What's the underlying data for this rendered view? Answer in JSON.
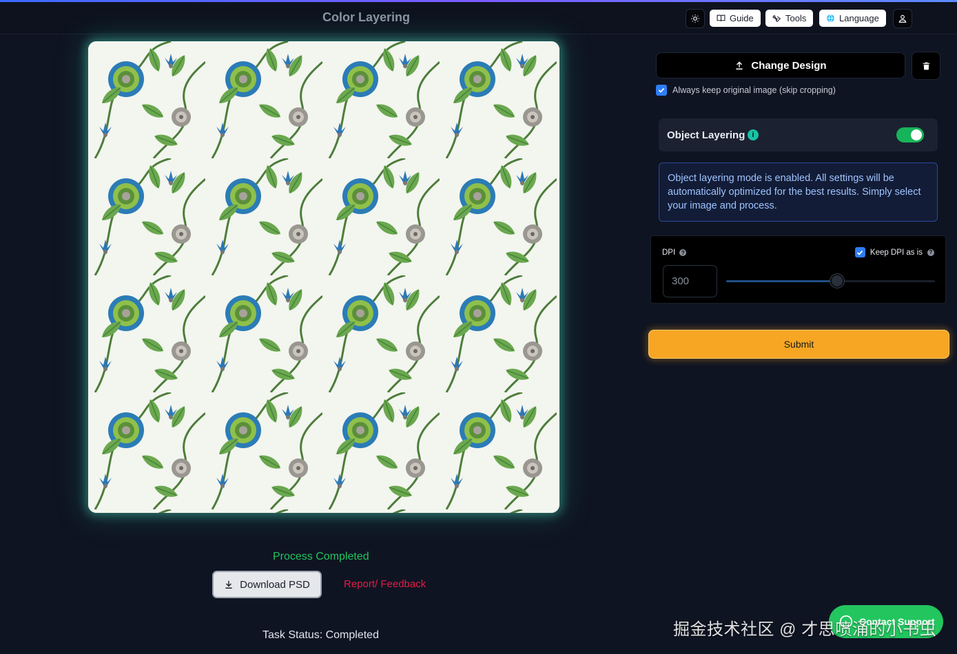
{
  "header": {
    "title": "Color Layering",
    "theme_icon": "sun-icon",
    "guide_label": "Guide",
    "tools_label": "Tools",
    "language_label": "Language",
    "user_icon": "user-icon"
  },
  "preview": {
    "image_icon": "floral-pattern-image",
    "process_status": "Process Completed",
    "download_label": "Download PSD",
    "report_label": "Report/ Feedback",
    "task_status": "Task Status: Completed"
  },
  "sidebar": {
    "change_design_label": "Change Design",
    "keep_original_label": "Always keep original image (skip cropping)",
    "keep_original_checked": true,
    "object_layering_label": "Object Layering",
    "object_layering_info": "i",
    "object_layering_enabled": true,
    "info_text": "Object layering mode is enabled. All settings will be automatically optimized for the best results. Simply select your image and process.",
    "dpi_label": "DPI",
    "dpi_help": "?",
    "keep_dpi_label": "Keep DPI as is",
    "keep_dpi_help": "?",
    "keep_dpi_checked": true,
    "dpi_value": "300",
    "dpi_slider_fraction": 0.53,
    "submit_label": "Submit"
  },
  "support": {
    "label": "Contact Support"
  },
  "watermark": {
    "text": "掘金技术社区 @ 才思喷涌的小书虫"
  },
  "colors": {
    "background": "#0f1422",
    "accent_orange": "#f6a623",
    "success_green": "#22c55e",
    "link_red": "#e11d48",
    "info_blue": "#9ec3ff"
  }
}
